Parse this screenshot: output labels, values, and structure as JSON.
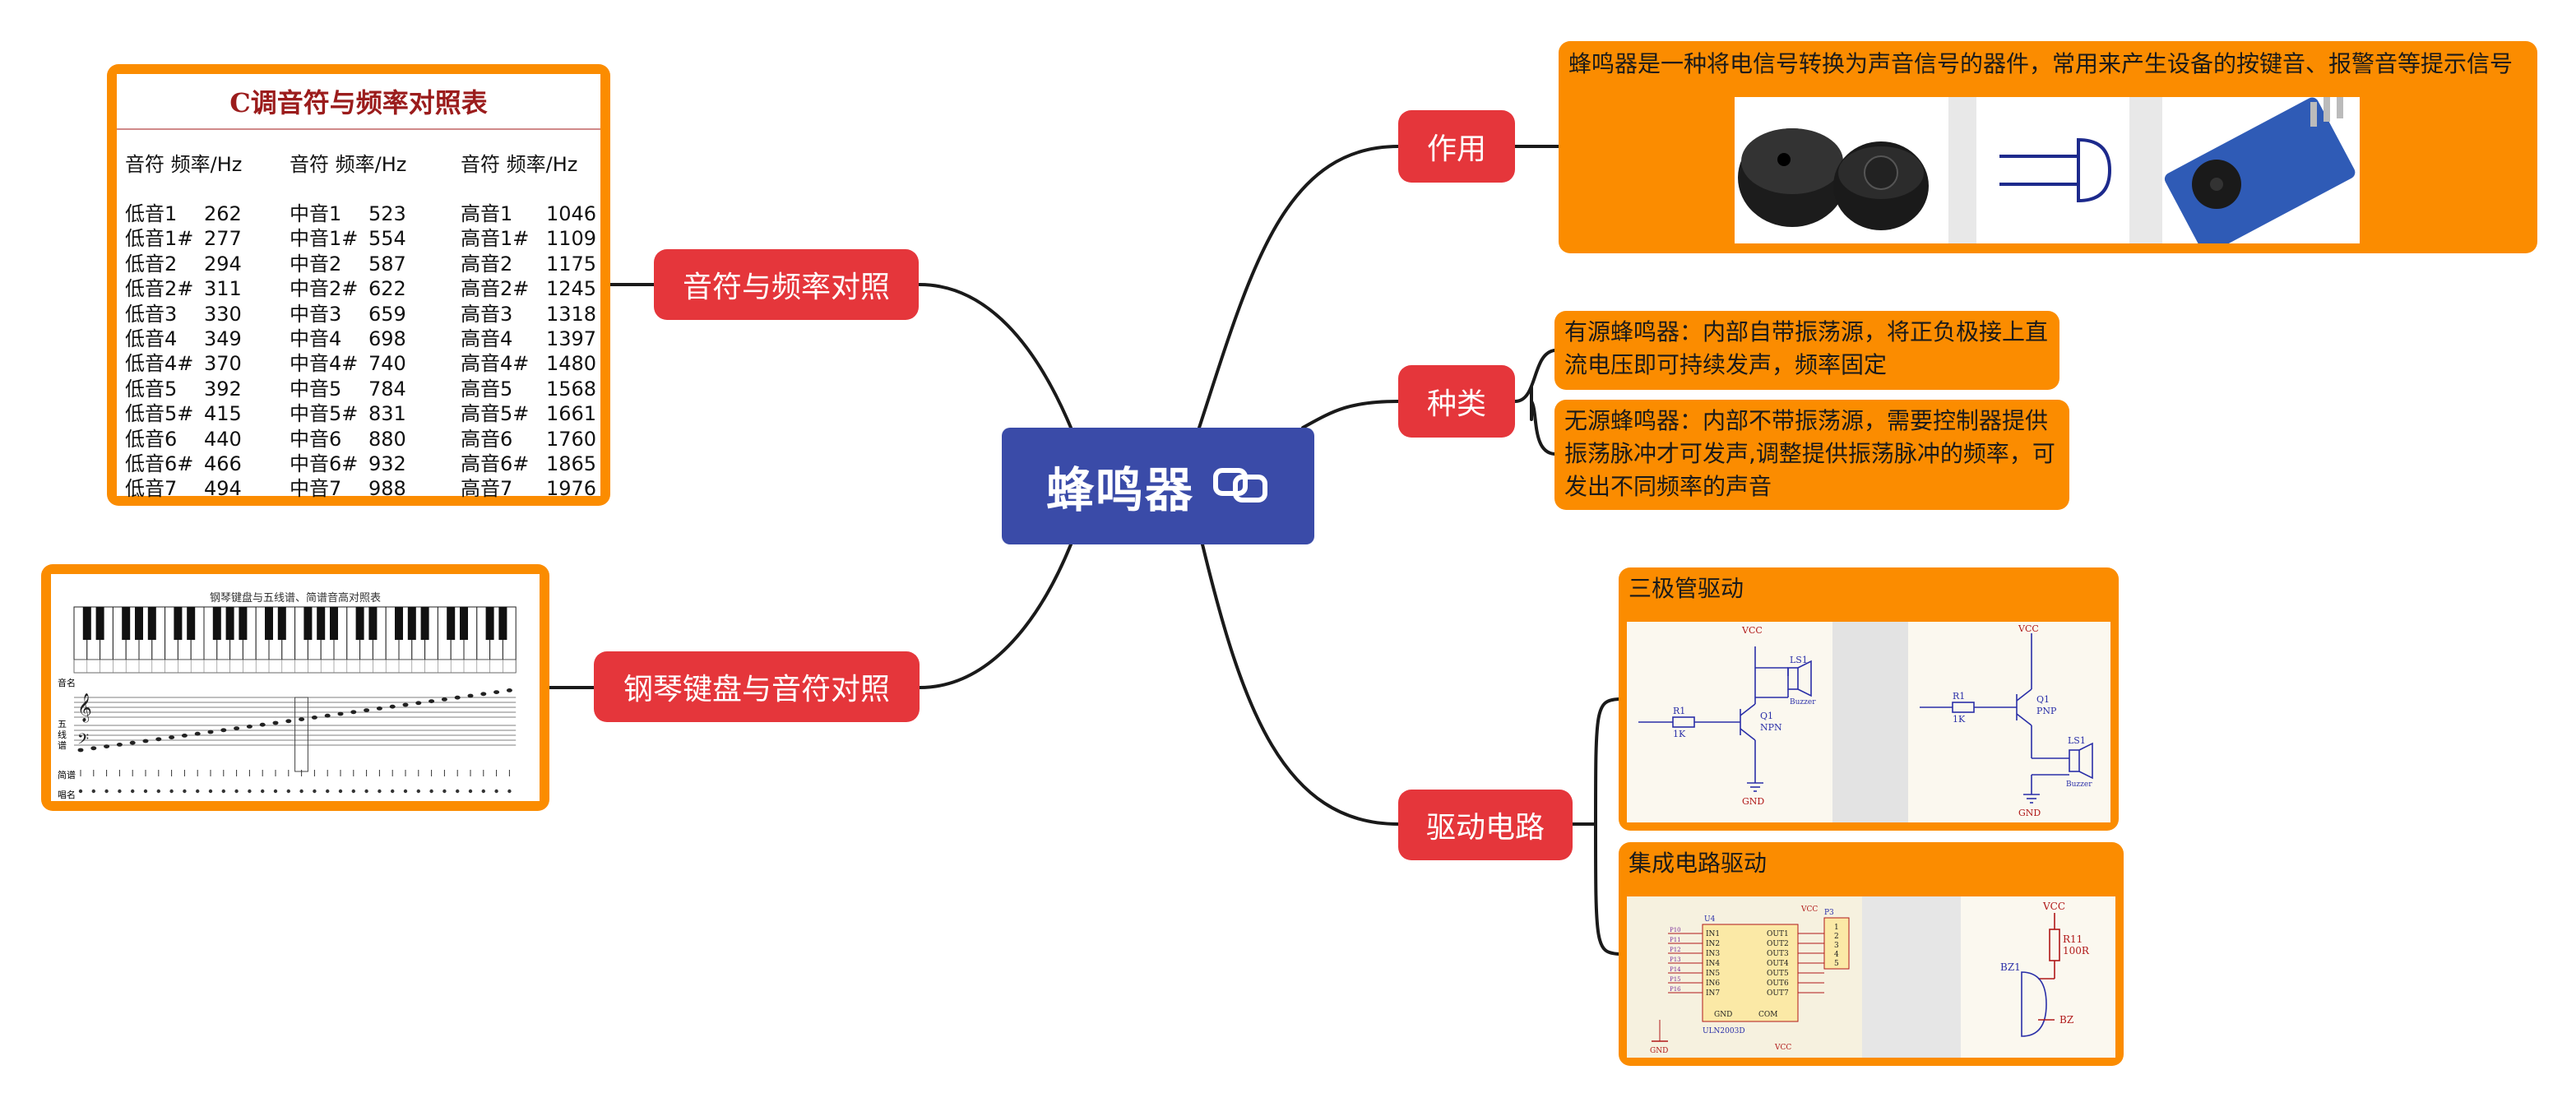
{
  "center": {
    "title": "蜂鸣器"
  },
  "branches": {
    "freq_table": "音符与频率对照",
    "piano": "钢琴键盘与音符对照",
    "purpose": "作用",
    "types": "种类",
    "drive": "驱动电路"
  },
  "purpose_text": "蜂鸣器是一种将电信号转换为声音信号的器件，常用来产生设备的按键音、报警音等提示信号",
  "types": [
    "有源蜂鸣器：内部自带振荡源，将正负极接上直流电压即可持续发声，频率固定",
    "无源蜂鸣器：内部不带振荡源，需要控制器提供振荡脉冲才可发声,调整提供振荡脉冲的频率，可发出不同频率的声音"
  ],
  "drive": {
    "transistor_title": "三极管驱动",
    "ic_title": "集成电路驱动"
  },
  "freq_table": {
    "title": "C调音符与频率对照表",
    "columns": [
      {
        "header": "音符 频率/Hz",
        "rows": [
          [
            "低音1",
            "262"
          ],
          [
            "低音1#",
            "277"
          ],
          [
            "低音2",
            "294"
          ],
          [
            "低音2#",
            "311"
          ],
          [
            "低音3",
            "330"
          ],
          [
            "低音4",
            "349"
          ],
          [
            "低音4#",
            "370"
          ],
          [
            "低音5",
            "392"
          ],
          [
            "低音5#",
            "415"
          ],
          [
            "低音6",
            "440"
          ],
          [
            "低音6#",
            "466"
          ],
          [
            "低音7",
            "494"
          ]
        ]
      },
      {
        "header": "音符 频率/Hz",
        "rows": [
          [
            "中音1",
            "523"
          ],
          [
            "中音1#",
            "554"
          ],
          [
            "中音2",
            "587"
          ],
          [
            "中音2#",
            "622"
          ],
          [
            "中音3",
            "659"
          ],
          [
            "中音4",
            "698"
          ],
          [
            "中音4#",
            "740"
          ],
          [
            "中音5",
            "784"
          ],
          [
            "中音5#",
            "831"
          ],
          [
            "中音6",
            "880"
          ],
          [
            "中音6#",
            "932"
          ],
          [
            "中音7",
            "988"
          ]
        ]
      },
      {
        "header": "音符 频率/Hz",
        "rows": [
          [
            "高音1",
            "1046"
          ],
          [
            "高音1#",
            "1109"
          ],
          [
            "高音2",
            "1175"
          ],
          [
            "高音2#",
            "1245"
          ],
          [
            "高音3",
            "1318"
          ],
          [
            "高音4",
            "1397"
          ],
          [
            "高音4#",
            "1480"
          ],
          [
            "高音5",
            "1568"
          ],
          [
            "高音5#",
            "1661"
          ],
          [
            "高音6",
            "1760"
          ],
          [
            "高音6#",
            "1865"
          ],
          [
            "高音7",
            "1976"
          ]
        ]
      }
    ]
  },
  "piano_image": {
    "title": "钢琴键盘与五线谱、简谱音高对照表",
    "row_labels": [
      "音名",
      "五线谱",
      "简谱",
      "唱名"
    ]
  },
  "circuits": {
    "npn": {
      "vcc": "VCC",
      "r": "R1",
      "r_val": "1K",
      "q": "Q1",
      "q_type": "NPN",
      "ls": "LS1",
      "buzzer": "Buzzer",
      "gnd": "GND"
    },
    "pnp": {
      "vcc": "VCC",
      "r": "R1",
      "r_val": "1K",
      "q": "Q1",
      "q_type": "PNP",
      "ls": "LS1",
      "buzzer": "Buzzer",
      "gnd": "GND"
    },
    "uln": {
      "chip": "ULN2003D",
      "u": "U4",
      "p": "P3",
      "vcc": "VCC",
      "gnd": "GND",
      "com": "COM",
      "gnd_pin": "GND",
      "inputs": [
        "IN1",
        "IN2",
        "IN3",
        "IN4",
        "IN5",
        "IN6",
        "IN7"
      ],
      "outputs": [
        "OUT1",
        "OUT2",
        "OUT3",
        "OUT4",
        "OUT5",
        "OUT6",
        "OUT7"
      ],
      "header_pins": [
        "1",
        "2",
        "3",
        "4",
        "5"
      ]
    },
    "bz": {
      "vcc": "VCC",
      "r": "R11",
      "r_val": "100R",
      "bz1": "BZ1",
      "bz": "BZ"
    }
  },
  "colors": {
    "center": "#3a4ba8",
    "branch": "#e5363b",
    "topic": "#fb8c00",
    "link": "#1a1a1a"
  }
}
